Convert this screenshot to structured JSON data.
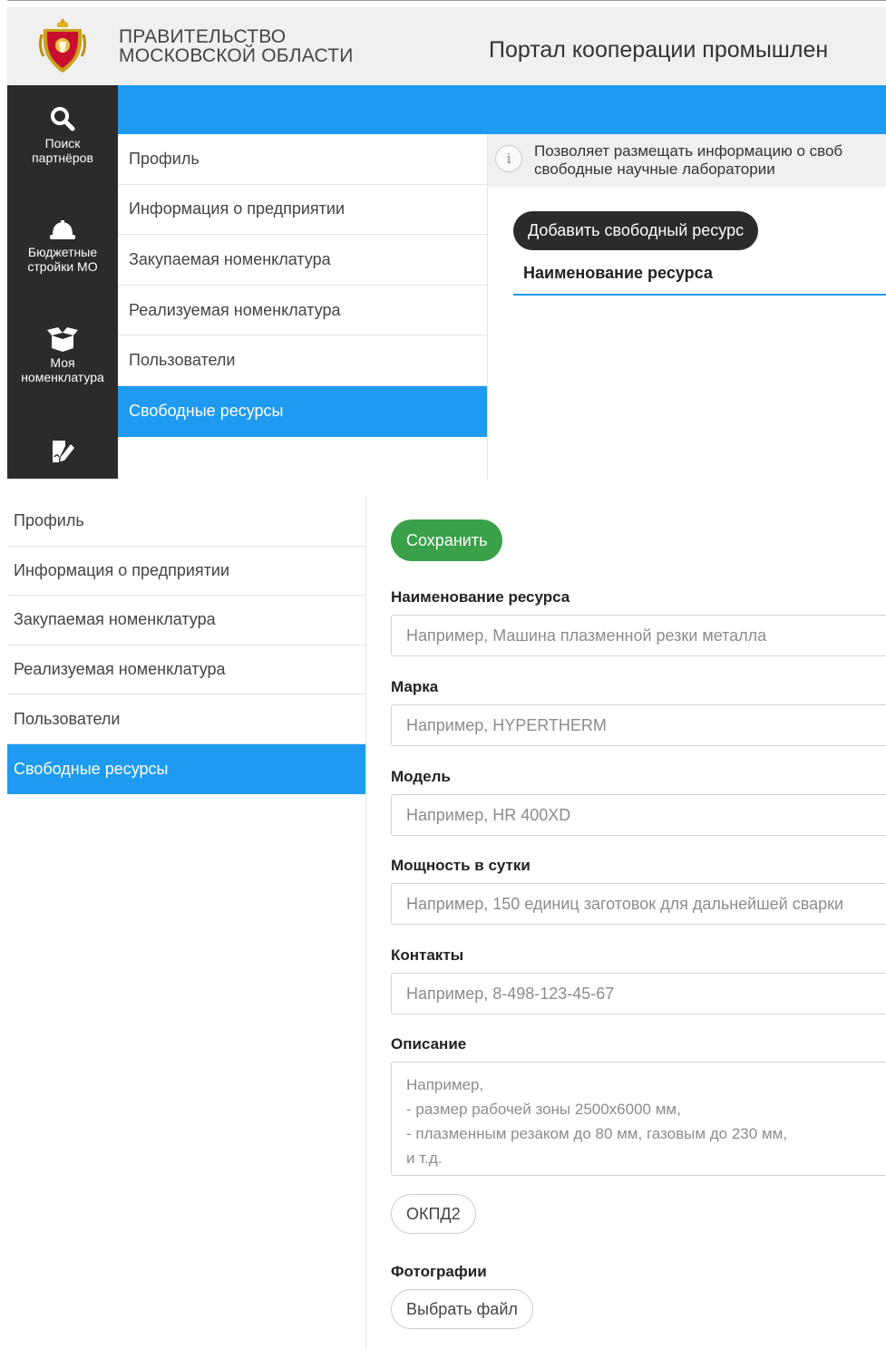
{
  "header": {
    "gov_line1": "ПРАВИТЕЛЬСТВО",
    "gov_line2": "МОСКОВСКОЙ ОБЛАСТИ",
    "portal_title": "Портал кооперации промышлен"
  },
  "leftnav": {
    "items": [
      {
        "label_line1": "Поиск",
        "label_line2": "партнёров",
        "icon": "search-icon"
      },
      {
        "label_line1": "Бюджетные",
        "label_line2": "стройки МО",
        "icon": "helmet-icon"
      },
      {
        "label_line1": "Моя",
        "label_line2": "номенклатура",
        "icon": "box-icon"
      },
      {
        "label_line1": "",
        "label_line2": "",
        "icon": "edit-document-icon"
      }
    ]
  },
  "submenu": {
    "items": [
      {
        "label": "Профиль"
      },
      {
        "label": "Информация о предприятии"
      },
      {
        "label": "Закупаемая номенклатура"
      },
      {
        "label": "Реализуемая номенклатура"
      },
      {
        "label": "Пользователи"
      },
      {
        "label": "Свободные ресурсы",
        "active": true
      }
    ]
  },
  "info": {
    "line1": "Позволяет размещать информацию о своб",
    "line2": "свободные научные лаборатории"
  },
  "resources": {
    "add_button": "Добавить свободный ресурс",
    "column_header": "Наименование ресурса"
  },
  "form": {
    "save_button": "Сохранить",
    "name": {
      "label": "Наименование ресурса",
      "placeholder": "Например, Машина плазменной резки металла"
    },
    "brand": {
      "label": "Марка",
      "placeholder": "Например, HYPERTHERM"
    },
    "model": {
      "label": "Модель",
      "placeholder": "Например, HR 400XD"
    },
    "capacity": {
      "label": "Мощность в сутки",
      "placeholder": "Например, 150 единиц заготовок для дальнейшей сварки"
    },
    "contacts": {
      "label": "Контакты",
      "placeholder": "Например, 8-498-123-45-67"
    },
    "description": {
      "label": "Описание",
      "placeholder": "Например,\n- размер рабочей зоны 2500х6000 мм,\n- плазменным резаком до 80 мм, газовым до 230 мм,\nи т.д."
    },
    "okpd_button": "ОКПД2",
    "photos": {
      "label": "Фотографии",
      "button": "Выбрать файл"
    }
  },
  "colors": {
    "accent_blue": "#1e9bf0",
    "sidebar_dark": "#2b2b2b",
    "save_green": "#3aa14a",
    "header_gray": "#f0f0f0"
  }
}
